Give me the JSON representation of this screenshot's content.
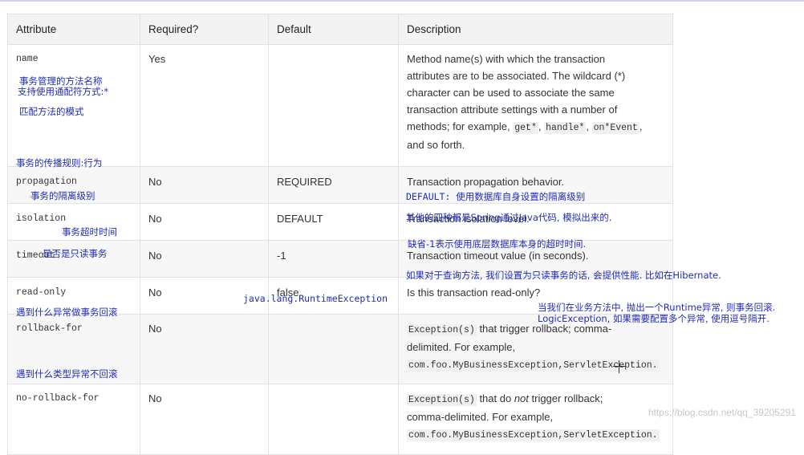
{
  "table": {
    "headers": [
      "Attribute",
      "Required?",
      "Default",
      "Description"
    ],
    "rows": [
      {
        "attribute": "name",
        "required": "Yes",
        "default": "",
        "desc_lines": [
          "Method name(s) with which the transaction",
          "attributes are to be associated. The wildcard (*)",
          "character can be used to associate the same",
          "transaction attribute settings with a number of"
        ],
        "desc_example_prefix": "methods; for example, ",
        "desc_codes": [
          "get*",
          "handle*",
          "on*Event"
        ],
        "desc_sep": ", ",
        "desc_tail": "and so forth."
      },
      {
        "attribute": "propagation",
        "required": "No",
        "default": "REQUIRED",
        "desc": "Transaction propagation behavior."
      },
      {
        "attribute": "isolation",
        "required": "No",
        "default": "DEFAULT",
        "desc": "Transaction isolation level."
      },
      {
        "attribute": "timeout",
        "required": "No",
        "default": "-1",
        "desc": "Transaction timeout value (in seconds)."
      },
      {
        "attribute": "read-only",
        "required": "No",
        "default": "false",
        "desc": "Is this transaction read-only?"
      },
      {
        "attribute": "rollback-for",
        "required": "No",
        "default": "",
        "desc_code": "Exception(s)",
        "desc_text": " that trigger rollback; comma-",
        "desc_line2": "delimited. For example,",
        "desc_example": "com.foo.MyBusinessException,ServletException."
      },
      {
        "attribute": "no-rollback-for",
        "required": "No",
        "default": "",
        "desc_code": "Exception(s)",
        "desc_text_a": " that do ",
        "desc_text_em": "not",
        "desc_text_b": " trigger rollback;",
        "desc_line2": "comma-delimited. For example,",
        "desc_example": "com.foo.MyBusinessException,ServletException."
      }
    ]
  },
  "annotations": {
    "name_1": "事务管理的方法名称",
    "name_2": "支持使用通配符方式:*",
    "name_3": "匹配方法的模式",
    "propagation": "事务的传播规则:行为",
    "isolation": "事务的隔离级别",
    "isolation_default": "DEFAULT: 使用数据库自身设置的隔离级别",
    "isolation_others": "其他的四种都是Spring通过Java代码, 模拟出来的.",
    "timeout": "事务超时时间",
    "timeout_default": "缺省-1表示使用底层数据库本身的超时时间.",
    "readonly": "是否是只读事务",
    "readonly_desc": "如果对于查询方法, 我们设置为只读事务的话, 会提供性能. 比如在Hibernate.",
    "rollback_default": "java.lang.RuntimeException",
    "rollback": "遇到什么异常做事务回滚",
    "rollback_desc_1": "当我们在业务方法中, 抛出一个Runtime异常, 则事务回滚.",
    "rollback_desc_2": "LogicException, 如果需要配置多个异常, 使用逗号隔开.",
    "norollback": "遇到什么类型异常不回滚"
  },
  "watermark": "https://blog.csdn.net/qq_39205291"
}
